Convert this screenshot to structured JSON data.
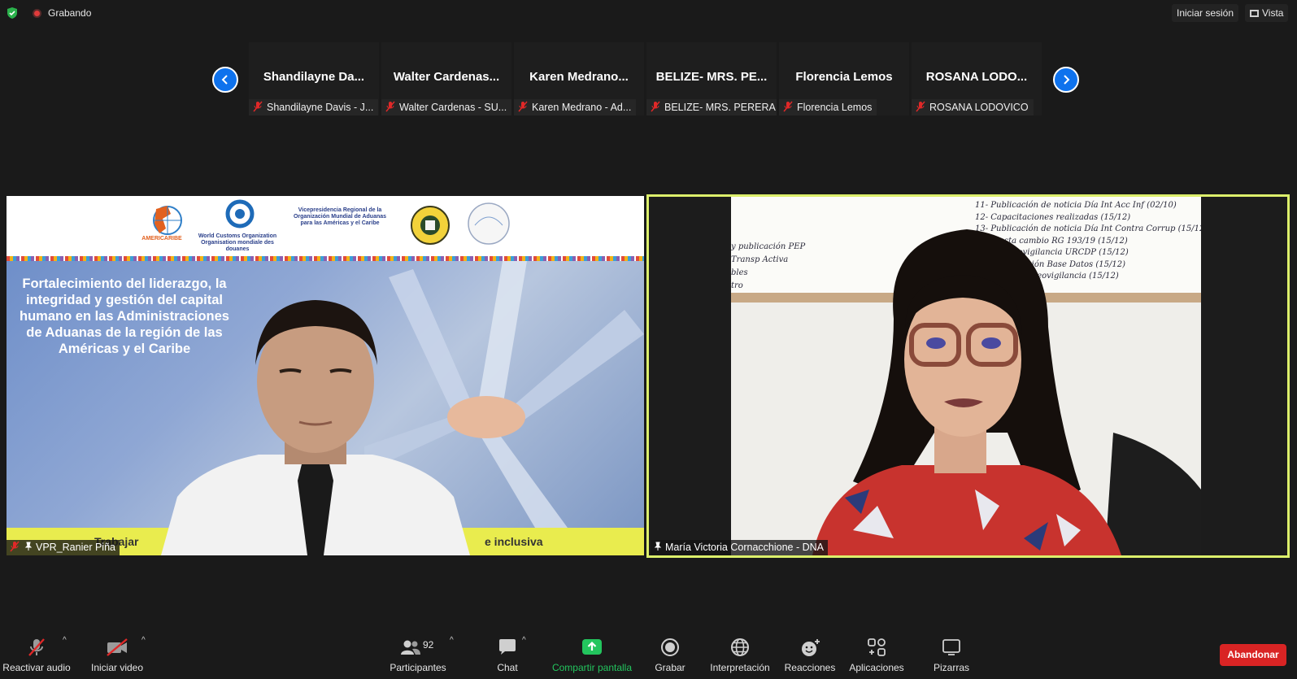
{
  "topbar": {
    "recording_label": "Grabando",
    "signin_label": "Iniciar sesión",
    "view_label": "Vista"
  },
  "strip": {
    "tiles": [
      {
        "name": "Shandilayne Da...",
        "label": "Shandilayne Davis - J..."
      },
      {
        "name": "Walter Cardenas...",
        "label": "Walter Cardenas - SU..."
      },
      {
        "name": "Karen Medrano...",
        "label": "Karen Medrano - Ad..."
      },
      {
        "name": "BELIZE- MRS. PE...",
        "label": "BELIZE- MRS. PERERA"
      },
      {
        "name": "Florencia Lemos",
        "label": "Florencia Lemos"
      },
      {
        "name": "ROSANA LODO...",
        "label": "ROSANA LODOVICO"
      }
    ]
  },
  "left_video": {
    "slide_title": "Fortalecimiento del liderazgo, la integridad y gestión del capital humano en las Administraciones de Aduanas de la región de las Américas y el Caribe",
    "footer_left": "Trabajar",
    "footer_right": "e inclusiva",
    "logo_americaribe": "AMERICARIBE",
    "logo_wco": "World Customs Organization Organisation mondiale des douanes",
    "logo_vpr": "Vicepresidencia Regional de la Organización Mundial de Aduanas para las Américas y el Caribe",
    "participant_name": "VPR_Ranier Piña"
  },
  "right_video": {
    "participant_name": "María Victoria Cornacchione - DNA",
    "whiteboard_lines": [
      "11- Publicación de noticia Día Int Acc Inf (02/10)",
      "12- Capacitaciones realizadas (15/12)",
      "13- Publicación de noticia Día Int Contra Corrup (15/12)",
      "propuesta cambio RG 193/19 (15/12)",
      "sobre videovigilancia URCDP (15/12)",
      "n y actualización Base Datos (15/12)",
      "de logos de videovigilancia (15/12)"
    ],
    "whiteboard_left": [
      "y publicación PEP",
      "Transp Activa",
      "bles",
      "tro"
    ]
  },
  "toolbar": {
    "audio_label": "Reactivar audio",
    "video_label": "Iniciar video",
    "participants_label": "Participantes",
    "participants_count": "92",
    "chat_label": "Chat",
    "share_label": "Compartir pantalla",
    "record_label": "Grabar",
    "interpretation_label": "Interpretación",
    "reactions_label": "Reacciones",
    "apps_label": "Aplicaciones",
    "whiteboards_label": "Pizarras",
    "leave_label": "Abandonar"
  },
  "colors": {
    "accent_blue": "#0e72ed",
    "share_green": "#23c55e",
    "leave_red": "#d92424",
    "active_speaker": "#dcef6b"
  }
}
